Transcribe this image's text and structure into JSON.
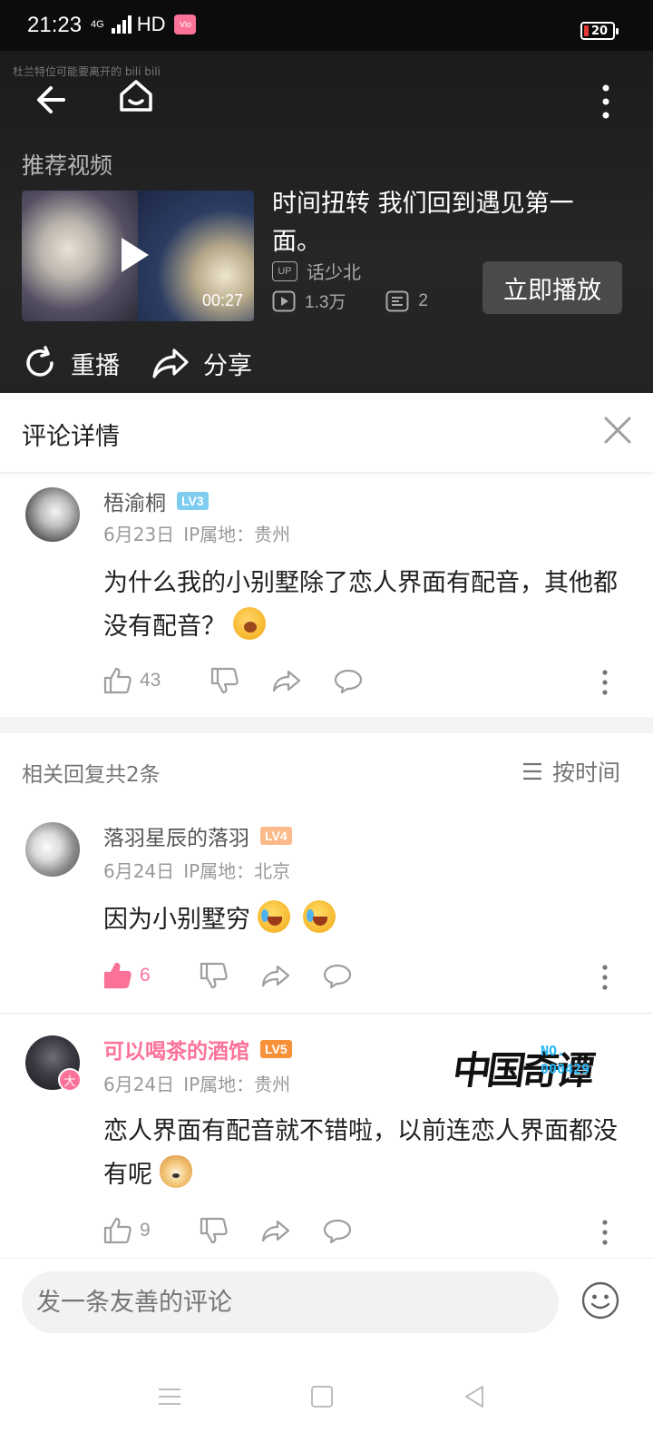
{
  "status_bar": {
    "time": "21:23",
    "network_small": "4G",
    "network": "HD",
    "app_badge": "Vlo",
    "battery": "20"
  },
  "video_panel": {
    "ghost_text": "杜兰特位可能要离开的 bili bili",
    "section_title": "推荐视频",
    "thumbnail_duration": "00:27",
    "title": "时间扭转 我们回到遇见第一面。",
    "uploader_badge": "UP",
    "uploader": "话少北",
    "views": "1.3万",
    "danmaku": "2",
    "play_button": "立即播放",
    "replay": "重播",
    "share": "分享"
  },
  "comment_panel": {
    "title": "评论详情"
  },
  "main_comment": {
    "username": "梧渝桐",
    "level": "LV3",
    "level_color": "#7ecdf1",
    "date": "6月23日",
    "location": "IP属地：贵州",
    "text": "为什么我的小别墅除了恋人界面有配音，其他都没有配音？",
    "emoji": "yawn-emoji",
    "likes": "43"
  },
  "replies_header": {
    "count_label": "相关回复共2条",
    "sort_label": "按时间"
  },
  "replies": [
    {
      "username": "落羽星辰的落羽",
      "level": "LV4",
      "level_color": "#fcb98a",
      "date": "6月24日",
      "location": "IP属地：北京",
      "text": "因为小别墅穷",
      "emojis": [
        "laugh-cry-emoji",
        "laugh-cry-emoji"
      ],
      "likes": "6",
      "liked": true,
      "like_color": "#fb7299"
    },
    {
      "username": "可以喝茶的酒馆",
      "level": "LV5",
      "level_color": "#f7913a",
      "name_color": "#fb7299",
      "avatar_badge": "大",
      "date": "6月24日",
      "location": "IP属地：贵州",
      "text": "恋人界面有配音就不错啦，以前连恋人界面都没有呢",
      "emoji": "doge-emoji",
      "likes": "9",
      "liked": false,
      "brand_decoration": {
        "calligraphy": "中国奇谭",
        "number_label": "NO.",
        "number": "000429"
      }
    }
  ],
  "input_bar": {
    "placeholder": "发一条友善的评论"
  }
}
